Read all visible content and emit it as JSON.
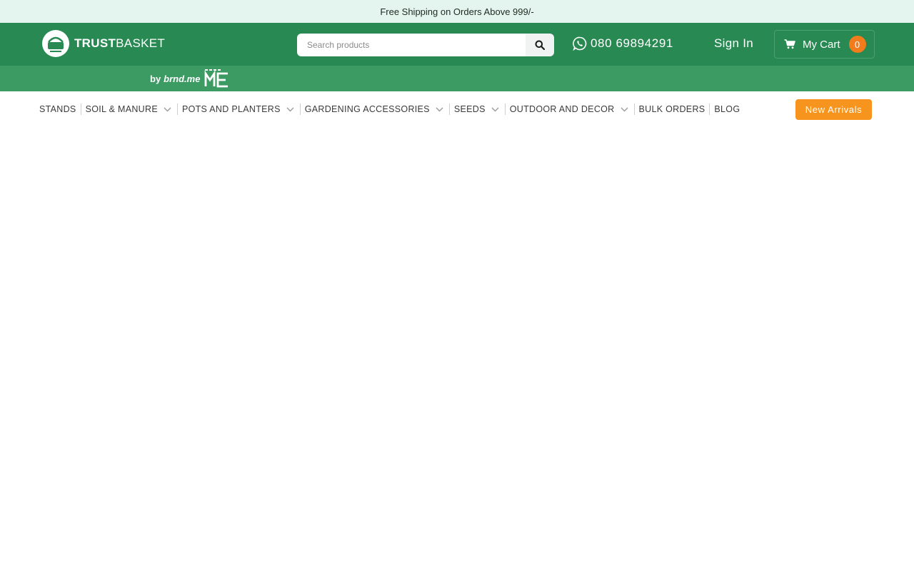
{
  "announcement": "Free Shipping on Orders Above 999/-",
  "brand": {
    "name_bold": "TRUST",
    "name_light": "BASKET",
    "by_text": "by",
    "partner": "brnd.me"
  },
  "search": {
    "placeholder": "Search products",
    "value": ""
  },
  "contact": {
    "phone": "080 69894291",
    "icon": "whatsapp-icon"
  },
  "account": {
    "signin_label": "Sign In"
  },
  "cart": {
    "label": "My Cart",
    "count": "0"
  },
  "nav": {
    "items": [
      {
        "label": "STANDS",
        "has_dropdown": false
      },
      {
        "label": "SOIL & MANURE",
        "has_dropdown": true
      },
      {
        "label": "POTS AND PLANTERS",
        "has_dropdown": true
      },
      {
        "label": "GARDENING ACCESSORIES",
        "has_dropdown": true
      },
      {
        "label": "SEEDS",
        "has_dropdown": true
      },
      {
        "label": "OUTDOOR AND DECOR",
        "has_dropdown": true
      },
      {
        "label": "BULK ORDERS",
        "has_dropdown": false
      },
      {
        "label": "BLOG",
        "has_dropdown": false
      }
    ],
    "cta_label": "New Arrivals"
  },
  "colors": {
    "header_green": "#288a52",
    "subbar_green": "#3c9a63",
    "announce_bg": "#e3f5ee",
    "accent_orange": "#f7941d",
    "cart_badge": "#f27c1c"
  }
}
